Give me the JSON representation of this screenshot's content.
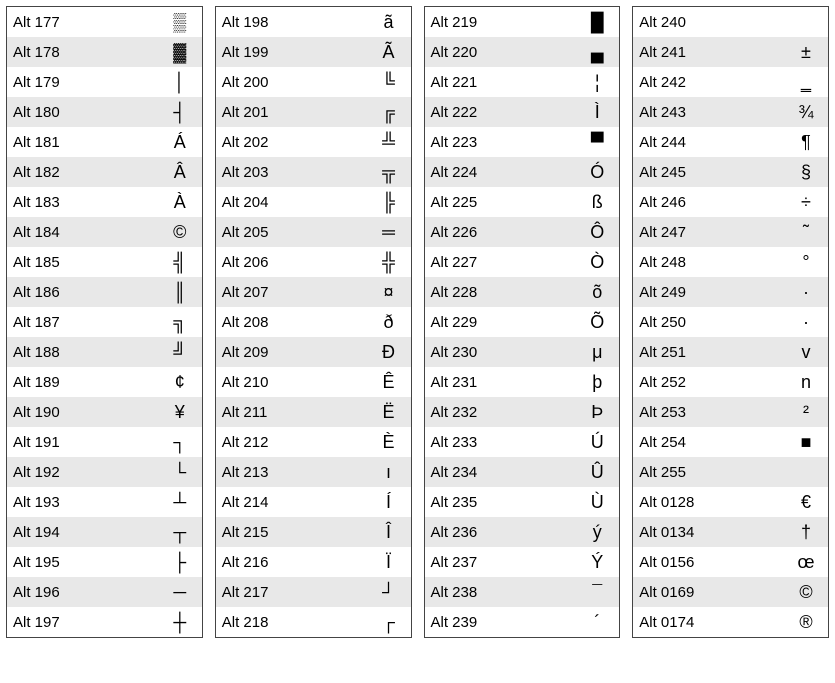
{
  "columns": [
    {
      "rows": [
        {
          "code": "Alt 177",
          "symbol": "▒"
        },
        {
          "code": "Alt 178",
          "symbol": "▓"
        },
        {
          "code": "Alt 179",
          "symbol": "│"
        },
        {
          "code": "Alt 180",
          "symbol": "┤"
        },
        {
          "code": "Alt 181",
          "symbol": "Á"
        },
        {
          "code": "Alt 182",
          "symbol": "Â"
        },
        {
          "code": "Alt 183",
          "symbol": "À"
        },
        {
          "code": "Alt 184",
          "symbol": "©"
        },
        {
          "code": "Alt 185",
          "symbol": "╣"
        },
        {
          "code": "Alt 186",
          "symbol": "║"
        },
        {
          "code": "Alt 187",
          "symbol": "╗"
        },
        {
          "code": "Alt 188",
          "symbol": "╝"
        },
        {
          "code": "Alt 189",
          "symbol": "¢"
        },
        {
          "code": "Alt 190",
          "symbol": "¥"
        },
        {
          "code": "Alt 191",
          "symbol": "┐"
        },
        {
          "code": "Alt 192",
          "symbol": "└"
        },
        {
          "code": "Alt 193",
          "symbol": "┴"
        },
        {
          "code": "Alt 194",
          "symbol": "┬"
        },
        {
          "code": "Alt 195",
          "symbol": "├"
        },
        {
          "code": "Alt 196",
          "symbol": "─"
        },
        {
          "code": "Alt 197",
          "symbol": "┼"
        }
      ]
    },
    {
      "rows": [
        {
          "code": "Alt 198",
          "symbol": "ã"
        },
        {
          "code": "Alt 199",
          "symbol": "Ã"
        },
        {
          "code": "Alt 200",
          "symbol": "╚"
        },
        {
          "code": "Alt 201",
          "symbol": "╔"
        },
        {
          "code": "Alt 202",
          "symbol": "╩"
        },
        {
          "code": "Alt 203",
          "symbol": "╦"
        },
        {
          "code": "Alt 204",
          "symbol": "╠"
        },
        {
          "code": "Alt 205",
          "symbol": "═"
        },
        {
          "code": "Alt 206",
          "symbol": "╬"
        },
        {
          "code": "Alt 207",
          "symbol": "¤"
        },
        {
          "code": "Alt 208",
          "symbol": "ð"
        },
        {
          "code": "Alt 209",
          "symbol": "Ð"
        },
        {
          "code": "Alt 210",
          "symbol": "Ê"
        },
        {
          "code": "Alt 211",
          "symbol": "Ë"
        },
        {
          "code": "Alt 212",
          "symbol": "È"
        },
        {
          "code": "Alt 213",
          "symbol": "ı"
        },
        {
          "code": "Alt 214",
          "symbol": "Í"
        },
        {
          "code": "Alt 215",
          "symbol": "Î"
        },
        {
          "code": "Alt 216",
          "symbol": "Ï"
        },
        {
          "code": "Alt 217",
          "symbol": "┘"
        },
        {
          "code": "Alt 218",
          "symbol": "┌"
        }
      ]
    },
    {
      "rows": [
        {
          "code": "Alt 219",
          "symbol": "█"
        },
        {
          "code": "Alt 220",
          "symbol": "▄"
        },
        {
          "code": "Alt 221",
          "symbol": "¦"
        },
        {
          "code": "Alt 222",
          "symbol": "Ì"
        },
        {
          "code": "Alt 223",
          "symbol": "▀"
        },
        {
          "code": "Alt 224",
          "symbol": "Ó"
        },
        {
          "code": "Alt 225",
          "symbol": "ß"
        },
        {
          "code": "Alt 226",
          "symbol": "Ô"
        },
        {
          "code": "Alt 227",
          "symbol": "Ò"
        },
        {
          "code": "Alt 228",
          "symbol": "õ"
        },
        {
          "code": "Alt 229",
          "symbol": "Õ"
        },
        {
          "code": "Alt 230",
          "symbol": "μ"
        },
        {
          "code": "Alt 231",
          "symbol": "þ"
        },
        {
          "code": "Alt 232",
          "symbol": "Þ"
        },
        {
          "code": "Alt 233",
          "symbol": "Ú"
        },
        {
          "code": "Alt 234",
          "symbol": "Û"
        },
        {
          "code": "Alt 235",
          "symbol": "Ù"
        },
        {
          "code": "Alt 236",
          "symbol": "ý"
        },
        {
          "code": "Alt 237",
          "symbol": "Ý"
        },
        {
          "code": "Alt 238",
          "symbol": "¯"
        },
        {
          "code": "Alt 239",
          "symbol": "´"
        }
      ]
    },
    {
      "rows": [
        {
          "code": "Alt 240",
          "symbol": ""
        },
        {
          "code": "Alt 241",
          "symbol": "±"
        },
        {
          "code": "Alt 242",
          "symbol": "‗"
        },
        {
          "code": "Alt 243",
          "symbol": "¾"
        },
        {
          "code": "Alt 244",
          "symbol": "¶"
        },
        {
          "code": "Alt 245",
          "symbol": "§"
        },
        {
          "code": "Alt 246",
          "symbol": "÷"
        },
        {
          "code": "Alt 247",
          "symbol": "˜"
        },
        {
          "code": "Alt 248",
          "symbol": "°"
        },
        {
          "code": "Alt 249",
          "symbol": "·"
        },
        {
          "code": "Alt 250",
          "symbol": "·"
        },
        {
          "code": "Alt 251",
          "symbol": "v"
        },
        {
          "code": "Alt 252",
          "symbol": "n"
        },
        {
          "code": "Alt 253",
          "symbol": "²"
        },
        {
          "code": "Alt 254",
          "symbol": "■"
        },
        {
          "code": "Alt 255",
          "symbol": ""
        },
        {
          "code": "Alt 0128",
          "symbol": "€"
        },
        {
          "code": "Alt 0134",
          "symbol": "†"
        },
        {
          "code": "Alt 0156",
          "symbol": "œ"
        },
        {
          "code": "Alt 0169",
          "symbol": "©"
        },
        {
          "code": "Alt 0174",
          "symbol": "®"
        }
      ]
    }
  ]
}
